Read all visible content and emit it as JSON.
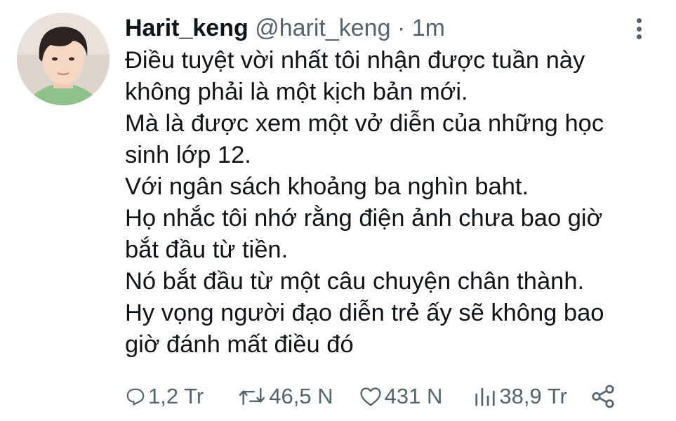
{
  "tweet": {
    "display_name": "Harit_keng",
    "handle": "@harit_keng",
    "separator": "·",
    "time": "1m",
    "lines": [
      "Điều tuyệt vời nhất tôi nhận được tuần này",
      "không phải là một kịch bản mới.",
      "Mà là được xem một vở diễn của những học",
      "sinh lớp 12.",
      "Với ngân sách khoảng ba nghìn baht.",
      "Họ nhắc tôi nhớ rằng điện ảnh chưa bao giờ",
      "bắt đầu từ tiền.",
      "Nó bắt đầu từ một câu chuyện chân thành.",
      "Hy vọng người đạo diễn trẻ ấy sẽ không bao",
      "giờ đánh mất điều đó"
    ]
  },
  "actions": {
    "reply": {
      "icon": "reply-icon",
      "count": "1,2 Tr"
    },
    "retweet": {
      "icon": "retweet-icon",
      "count": "46,5 N"
    },
    "like": {
      "icon": "heart-icon",
      "count": "431 N"
    },
    "views": {
      "icon": "views-icon",
      "count": "38,9 Tr"
    },
    "share": {
      "icon": "share-icon"
    }
  },
  "colors": {
    "text": "#0f1419",
    "secondary": "#536471",
    "background": "#ffffff"
  }
}
